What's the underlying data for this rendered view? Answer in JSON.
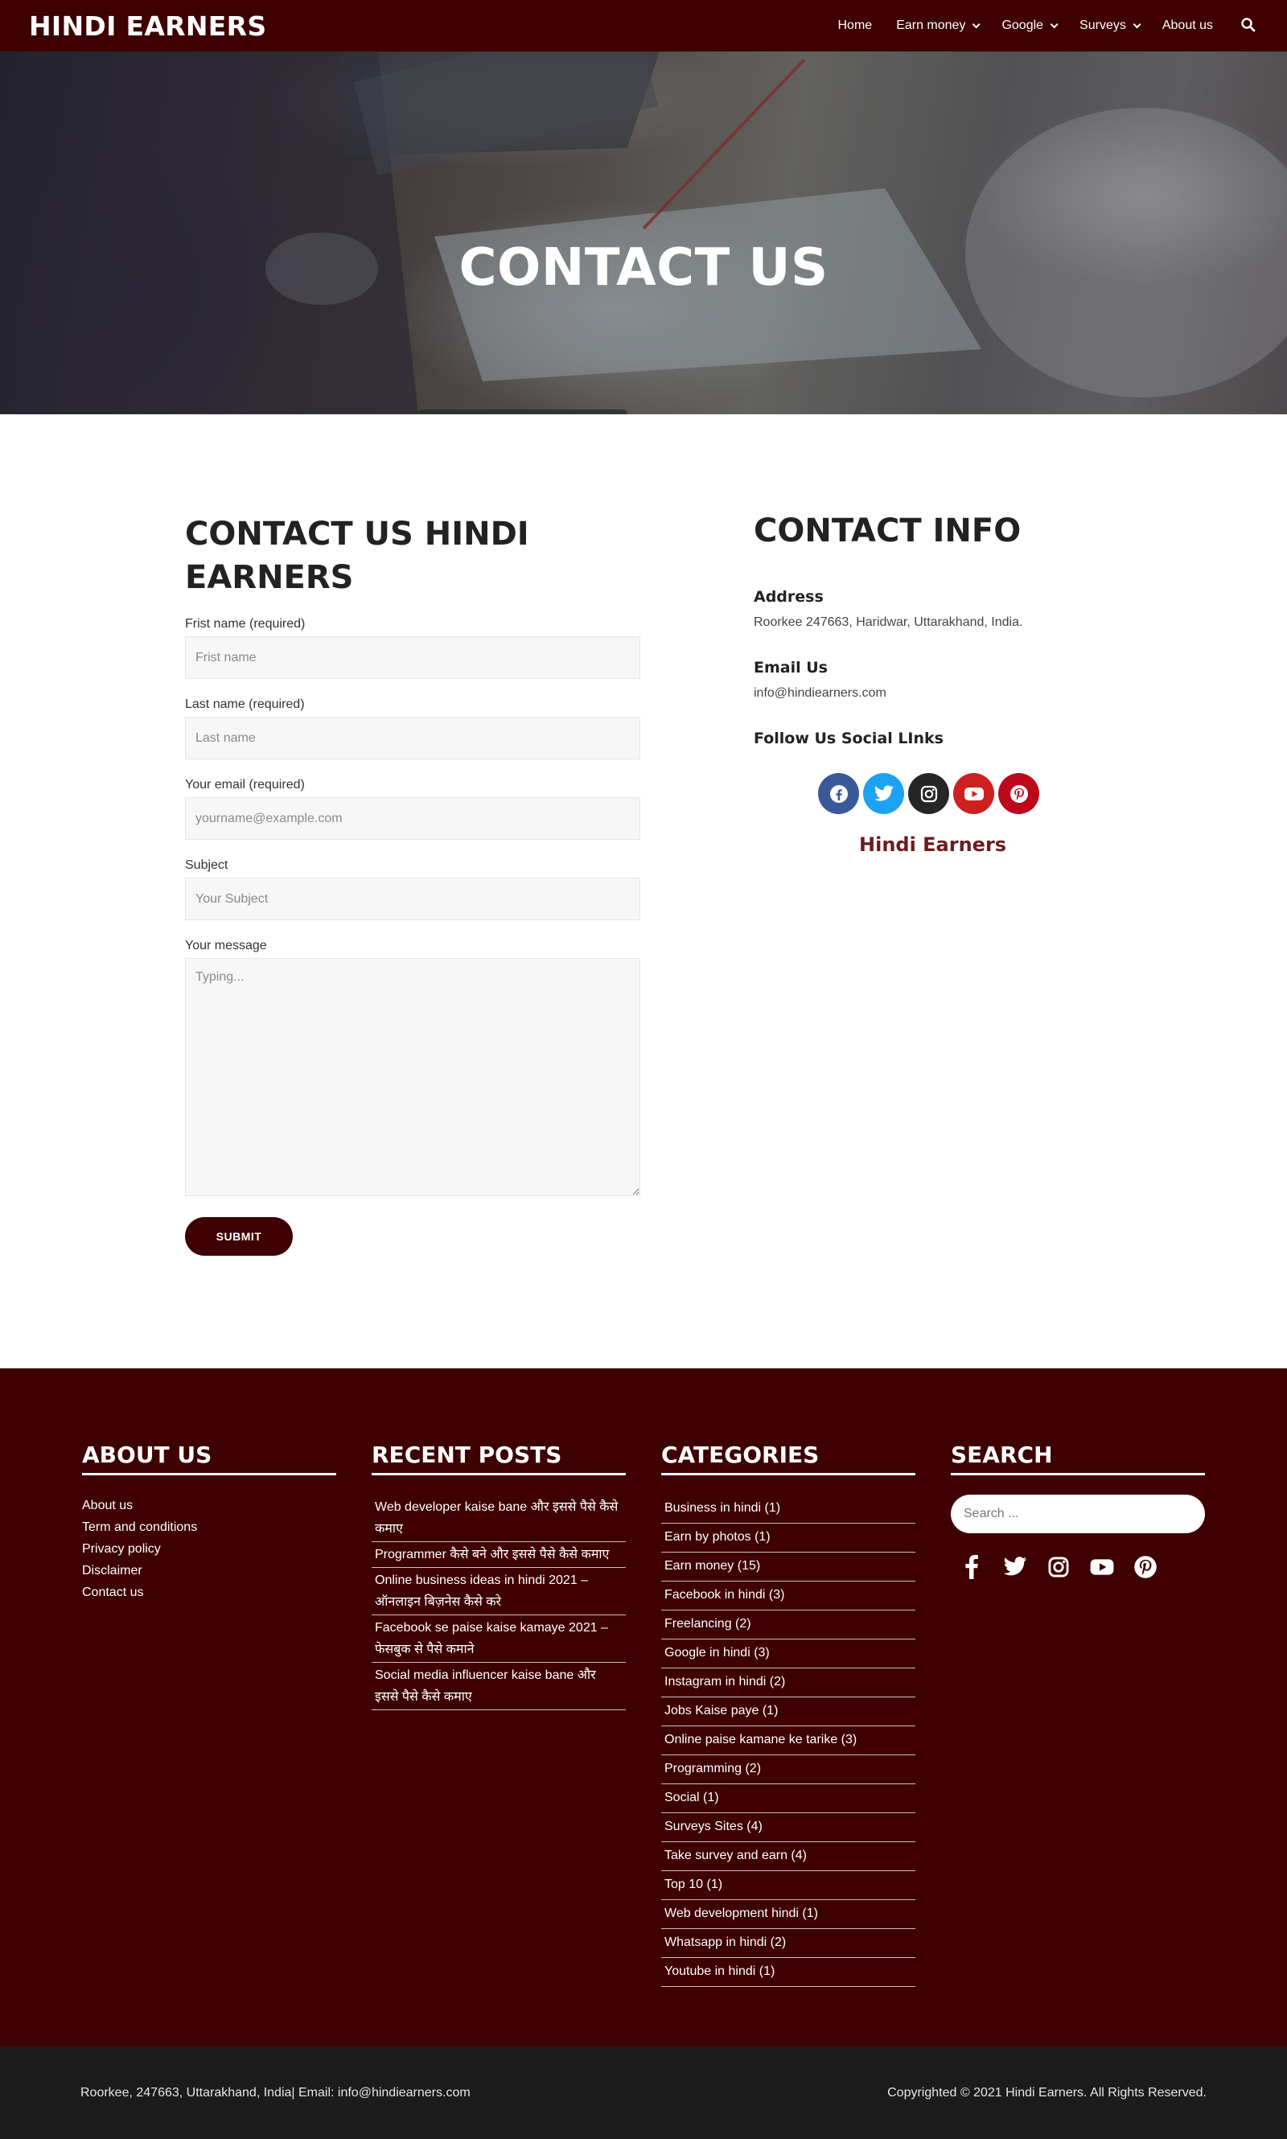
{
  "site": {
    "logo": "HINDI EARNERS"
  },
  "nav": {
    "items": [
      {
        "label": "Home",
        "dropdown": false
      },
      {
        "label": "Earn money",
        "dropdown": true
      },
      {
        "label": "Google",
        "dropdown": true
      },
      {
        "label": "Surveys",
        "dropdown": true
      },
      {
        "label": "About us",
        "dropdown": false
      }
    ],
    "search_icon": "search-icon"
  },
  "hero": {
    "title": "CONTACT US"
  },
  "form": {
    "heading": "CONTACT US HINDI EARNERS",
    "first_name_label": "Frist name (required)",
    "first_name_placeholder": "Frist name",
    "last_name_label": "Last name (required)",
    "last_name_placeholder": "Last name",
    "email_label": "Your email (required)",
    "email_placeholder": "yourname@example.com",
    "subject_label": "Subject",
    "subject_placeholder": "Your Subject",
    "message_label": "Your message",
    "message_placeholder": "Typing...",
    "submit_label": "SUBMIT"
  },
  "info": {
    "heading": "CONTACT INFO",
    "address_label": "Address",
    "address_value": "Roorkee 247663, Haridwar, Uttarakhand, India.",
    "email_label": "Email Us",
    "email_value": "info@hindiearners.com",
    "follow_label": "Follow Us Social LInks",
    "social": [
      {
        "icon": "facebook-icon",
        "color": "#3b5998"
      },
      {
        "icon": "twitter-icon",
        "color": "#1da1f2"
      },
      {
        "icon": "instagram-icon",
        "color": "#262626"
      },
      {
        "icon": "youtube-icon",
        "color": "#cd201f"
      },
      {
        "icon": "pinterest-icon",
        "color": "#bd081c"
      }
    ],
    "brand_name": "Hindi Earners"
  },
  "footer": {
    "about": {
      "heading": "ABOUT US",
      "links": [
        "About us",
        "Term and conditions",
        "Privacy policy",
        "Disclaimer",
        "Contact us"
      ]
    },
    "recent": {
      "heading": "RECENT POSTS",
      "posts": [
        "Web developer kaise bane और इससे पैसे कैसे कमाए",
        "Programmer कैसे बने और इससे पैसे कैसे कमाए",
        "Online business ideas in hindi 2021 – ऑनलाइन बिज़नेस कैसे करे",
        "Facebook se paise kaise kamaye 2021 – फेसबुक से पैसे कमाने",
        "Social media influencer kaise bane और इससे पैसे कैसे कमाए"
      ]
    },
    "categories": {
      "heading": "CATEGORIES",
      "items": [
        "Business in hindi (1)",
        "Earn by photos (1)",
        "Earn money (15)",
        "Facebook in hindi (3)",
        "Freelancing (2)",
        "Google in hindi (3)",
        "Instagram in hindi (2)",
        "Jobs Kaise paye (1)",
        "Online paise kamane ke tarike (3)",
        "Programming (2)",
        "Social (1)",
        "Surveys Sites (4)",
        "Take survey and earn (4)",
        "Top 10 (1)",
        "Web development hindi (1)",
        "Whatsapp in hindi (2)",
        "Youtube in hindi (1)"
      ]
    },
    "search": {
      "heading": "SEARCH",
      "placeholder": "Search ...",
      "social": [
        "facebook-icon",
        "twitter-icon",
        "instagram-icon",
        "youtube-icon",
        "pinterest-icon"
      ]
    }
  },
  "bottom_bar": {
    "address": "Roorkee, 247663, Uttarakhand, India| Email: info@hindiearners.com",
    "copyright": "Copyrighted © 2021 Hindi Earners. All Rights Reserved."
  },
  "colors": {
    "brand": "#3e0000",
    "bottom_bar": "#1b1b1b",
    "accent_text": "#6b1c20"
  }
}
